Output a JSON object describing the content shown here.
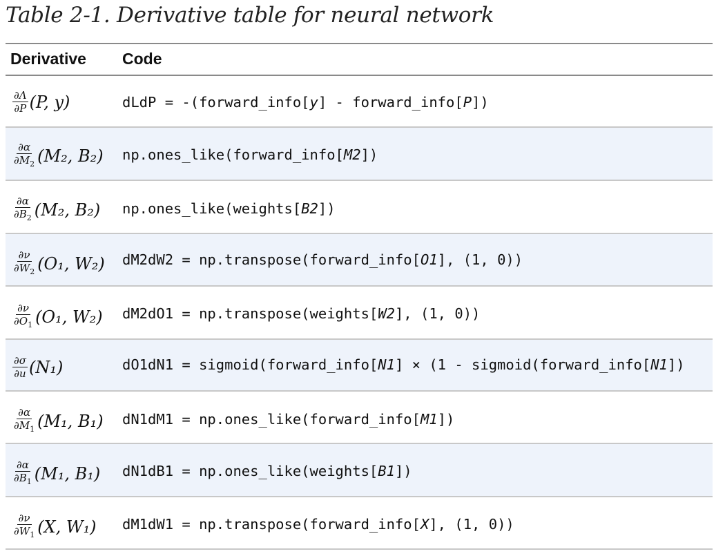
{
  "caption": "Table 2-1. Derivative table for neural network",
  "headers": {
    "derivative": "Derivative",
    "code": "Code"
  },
  "rows": [
    {
      "num": "∂Λ",
      "den": "∂P",
      "den_sub": "",
      "args": "(P, y)",
      "args_parts": [],
      "code_pre": "dLdP = -(forward_info[",
      "code_var1": "y",
      "code_mid": "] - forward_info[",
      "code_var2": "P",
      "code_post": "])"
    },
    {
      "num": "∂α",
      "den": "∂M",
      "den_sub": "2",
      "args": "(M₂, B₂)",
      "code_pre": "np.ones_like(forward_info[",
      "code_var1": "M2",
      "code_mid": "",
      "code_var2": "",
      "code_post": "])"
    },
    {
      "num": "∂α",
      "den": "∂B",
      "den_sub": "2",
      "args": "(M₂, B₂)",
      "code_pre": "np.ones_like(weights[",
      "code_var1": "B2",
      "code_mid": "",
      "code_var2": "",
      "code_post": "])"
    },
    {
      "num": "∂ν",
      "den": "∂W",
      "den_sub": "2",
      "args": "(O₁, W₂)",
      "code_pre": "dM2dW2 = np.transpose(forward_info[",
      "code_var1": "O1",
      "code_mid": "",
      "code_var2": "",
      "code_post": "], (1, 0))"
    },
    {
      "num": "∂ν",
      "den": "∂O",
      "den_sub": "1",
      "args": "(O₁, W₂)",
      "code_pre": "dM2dO1 = np.transpose(weights[",
      "code_var1": "W2",
      "code_mid": "",
      "code_var2": "",
      "code_post": "], (1, 0))"
    },
    {
      "num": "∂σ",
      "den": "∂u",
      "den_sub": "",
      "args": "(N₁)",
      "code_pre": "dO1dN1 = sigmoid(forward_info[",
      "code_var1": "N1",
      "code_mid": "] × (1 - sigmoid(forward_info[",
      "code_var2": "N1",
      "code_post": "])"
    },
    {
      "num": "∂α",
      "den": "∂M",
      "den_sub": "1",
      "args": "(M₁, B₁)",
      "code_pre": "dN1dM1 = np.ones_like(forward_info[",
      "code_var1": "M1",
      "code_mid": "",
      "code_var2": "",
      "code_post": "])"
    },
    {
      "num": "∂α",
      "den": "∂B",
      "den_sub": "1",
      "args": "(M₁, B₁)",
      "code_pre": "dN1dB1 = np.ones_like(weights[",
      "code_var1": "B1",
      "code_mid": "",
      "code_var2": "",
      "code_post": "])"
    },
    {
      "num": "∂ν",
      "den": "∂W",
      "den_sub": "1",
      "args": "(X, W₁)",
      "code_pre": "dM1dW1 = np.transpose(forward_info[",
      "code_var1": "X",
      "code_mid": "",
      "code_var2": "",
      "code_post": "], (1, 0))"
    }
  ]
}
